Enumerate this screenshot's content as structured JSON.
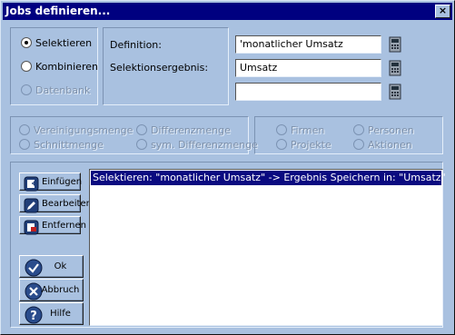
{
  "window": {
    "title": "Jobs definieren...",
    "close_label": "×"
  },
  "mode": {
    "options": [
      {
        "label": "Selektieren",
        "selected": true,
        "enabled": true
      },
      {
        "label": "Kombinieren",
        "selected": false,
        "enabled": true
      },
      {
        "label": "Datenbank",
        "selected": false,
        "enabled": false
      }
    ]
  },
  "definition": {
    "definition_label": "Definition:",
    "definition_value": "'monatlicher Umsatz",
    "result_label": "Selektionsergebnis:",
    "result_value": "Umsatz",
    "third_value": ""
  },
  "setops": {
    "options": [
      {
        "label": "Vereinigungsmenge"
      },
      {
        "label": "Differenzmenge"
      },
      {
        "label": "Schnittmenge"
      },
      {
        "label": "sym. Differenzmenge"
      }
    ]
  },
  "entities": {
    "options": [
      {
        "label": "Firmen"
      },
      {
        "label": "Personen"
      },
      {
        "label": "Projekte"
      },
      {
        "label": "Aktionen"
      }
    ]
  },
  "buttons": {
    "insert": "Einfügen",
    "edit": "Bearbeiten",
    "remove": "Entfernen",
    "ok": "Ok",
    "cancel": "Abbruch",
    "help": "Hilfe"
  },
  "jobs": {
    "items": [
      "Selektieren: \"monatlicher Umsatz\" -> Ergebnis Speichern in: \"Umsatz\""
    ],
    "selected_index": 0
  },
  "colors": {
    "title_bar": "#000080",
    "dialog_bg": "#a9c1e0",
    "selection": "#0a0a80"
  },
  "icons": {
    "calc": "calculator-icon",
    "insert": "insert-arrow-icon",
    "edit": "pencil-icon",
    "remove": "eraser-icon",
    "ok": "checkmark-icon",
    "cancel": "x-mark-icon",
    "help": "question-mark-icon"
  }
}
